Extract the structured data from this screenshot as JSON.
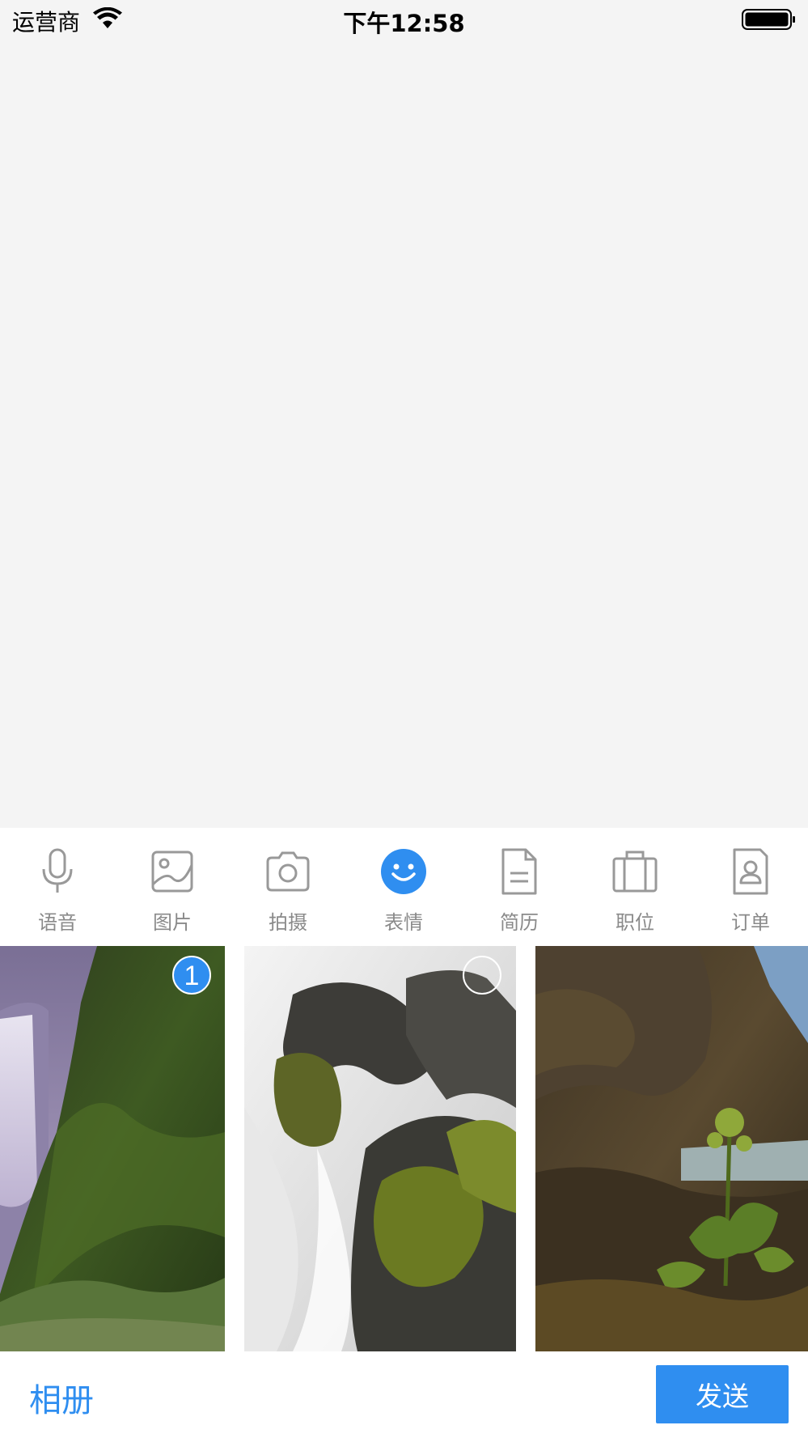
{
  "status_bar": {
    "carrier": "运营商",
    "time": "下午12:58"
  },
  "toolbar": {
    "items": [
      {
        "label": "语音",
        "icon": "microphone-icon"
      },
      {
        "label": "图片",
        "icon": "image-icon"
      },
      {
        "label": "拍摄",
        "icon": "camera-icon"
      },
      {
        "label": "表情",
        "icon": "emoji-icon"
      },
      {
        "label": "简历",
        "icon": "resume-icon"
      },
      {
        "label": "职位",
        "icon": "briefcase-icon"
      },
      {
        "label": "订单",
        "icon": "order-icon"
      }
    ],
    "active_index": 3,
    "icon_color": "#999999",
    "active_color": "#2f8ef0"
  },
  "photos": {
    "items": [
      {
        "selected": true,
        "order": "1"
      },
      {
        "selected": false
      },
      {
        "selected": false
      }
    ]
  },
  "bottom_bar": {
    "album_label": "相册",
    "send_label": "发送"
  },
  "colors": {
    "accent": "#2f8ef0",
    "background": "#f4f4f4"
  }
}
